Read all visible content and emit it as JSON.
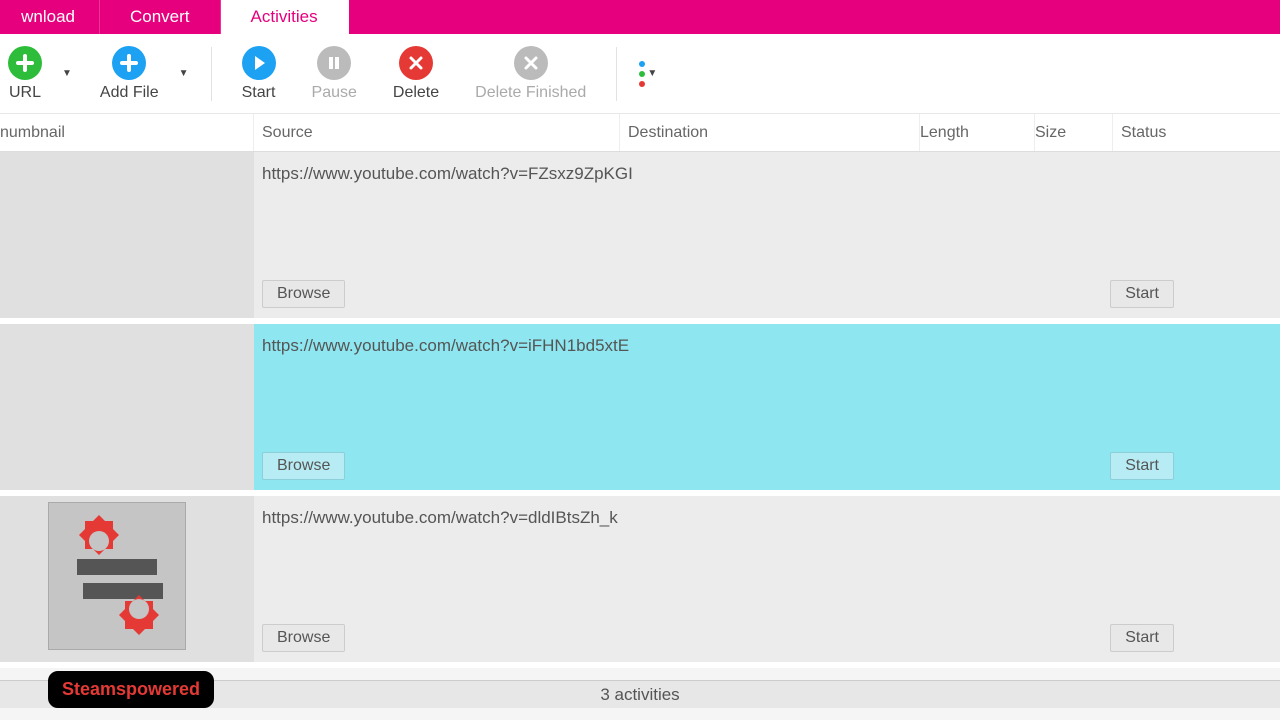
{
  "tabs": {
    "download": "wnload",
    "convert": "Convert",
    "activities": "Activities"
  },
  "toolbar": {
    "url": "URL",
    "addfile": "Add File",
    "start": "Start",
    "pause": "Pause",
    "delete": "Delete",
    "finished": "Delete Finished"
  },
  "columns": {
    "thumbnail": "numbnail",
    "source": "Source",
    "destination": "Destination",
    "length": "Length",
    "size": "Size",
    "status": "Status"
  },
  "rows": [
    {
      "url": "https://www.youtube.com/watch?v=FZsxz9ZpKGI",
      "browse": "Browse",
      "start": "Start"
    },
    {
      "url": "https://www.youtube.com/watch?v=iFHN1bd5xtE",
      "browse": "Browse",
      "start": "Start"
    },
    {
      "url": "https://www.youtube.com/watch?v=dldIBtsZh_k",
      "browse": "Browse",
      "start": "Start"
    }
  ],
  "statusbar": "3 activities",
  "watermark": "Steamspowered"
}
